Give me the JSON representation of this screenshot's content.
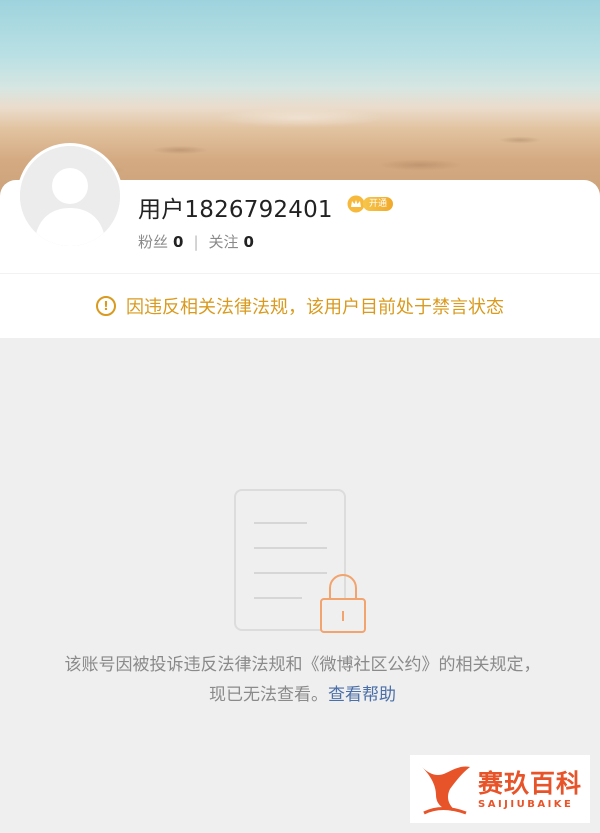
{
  "profile": {
    "username": "用户1826792401",
    "vip_label": "开通",
    "followers_label": "粉丝",
    "followers_count": "0",
    "separator": "|",
    "following_label": "关注",
    "following_count": "0"
  },
  "notice": {
    "icon": "!",
    "text": "因违反相关法律法规，该用户目前处于禁言状态"
  },
  "blocked": {
    "message": "该账号因被投诉违反法律法规和《微博社区公约》的相关规定，现已无法查看。",
    "help_link": "查看帮助"
  },
  "watermark": {
    "cn": "赛玖百科",
    "en": "SAIJIUBAIKE"
  },
  "colors": {
    "accent_orange": "#d99a1e",
    "link_blue": "#4b6fa8",
    "watermark_orange": "#e8542a",
    "lock_orange": "#f2a36e"
  },
  "icons": [
    "default-avatar-icon",
    "vip-crown-icon",
    "warning-circle-icon",
    "document-lock-icon",
    "watermark-logo-icon"
  ]
}
